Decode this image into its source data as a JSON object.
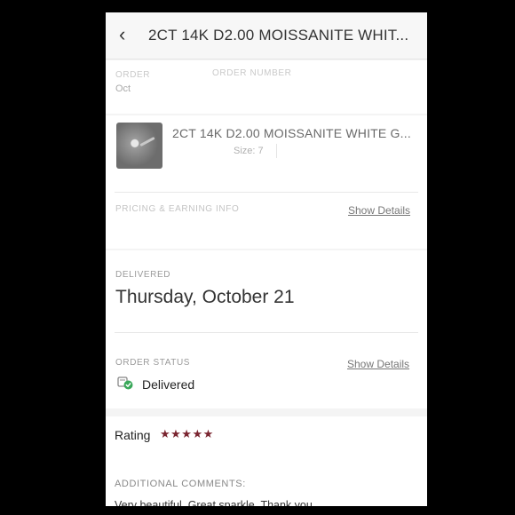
{
  "header": {
    "title": "2CT 14K D2.00 MOISSANITE WHIT...",
    "back_icon": "chevron-left-icon"
  },
  "order": {
    "date_label": "ORDER",
    "date_value": "Oct",
    "number_label": "ORDER NUMBER"
  },
  "product": {
    "name": "2CT 14K D2.00 MOISSANITE WHITE G...",
    "size": "Size: 7",
    "thumbnail_icon": "ring-thumbnail"
  },
  "pricing": {
    "label": "PRICING & EARNING INFO",
    "show_details": "Show Details"
  },
  "delivery": {
    "label": "DELIVERED",
    "date": "Thursday, October 21"
  },
  "order_status": {
    "label": "ORDER STATUS",
    "show_details": "Show Details",
    "status": "Delivered",
    "status_icon": "delivered-check-icon",
    "accent": "#3aa85a"
  },
  "rating": {
    "label": "Rating",
    "stars": "★★★★★",
    "value": 5,
    "max": 5,
    "star_color": "#7a2530"
  },
  "comments": {
    "label": "ADDITIONAL COMMENTS:",
    "text": "Very beautiful. Great sparkle. Thank you."
  }
}
